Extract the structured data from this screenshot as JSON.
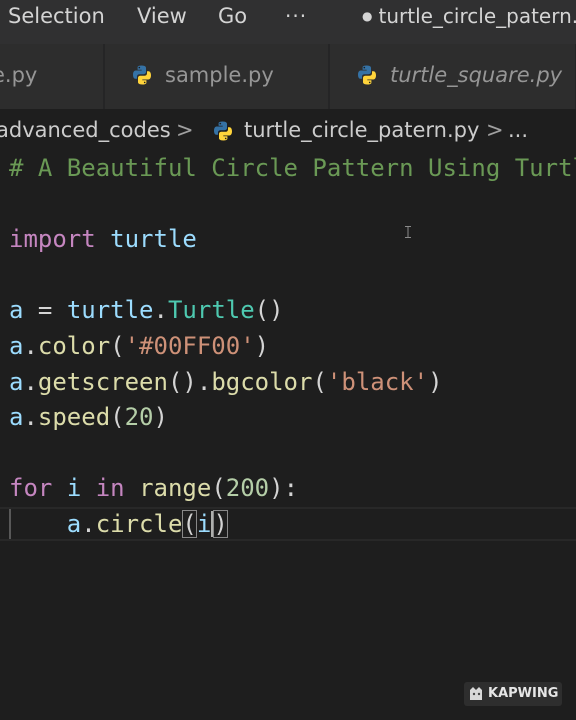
{
  "menu": {
    "items": [
      "Selection",
      "View",
      "Go",
      "···"
    ],
    "window_title": "turtle_circle_patern.py"
  },
  "tabs": [
    {
      "label": "turtle_circle.py",
      "visible_label": "e.py",
      "icon": "python-icon"
    },
    {
      "label": "sample.py",
      "icon": "python-icon"
    },
    {
      "label": "turtle_square.py",
      "icon": "python-icon",
      "italic": true
    }
  ],
  "breadcrumb": {
    "folder": "advanced_codes",
    "file": "turtle_circle_patern.py",
    "more": "...",
    "separator": ">"
  },
  "editor": {
    "lines": [
      [
        {
          "t": "# A Beautiful Circle Pattern Using Turtle",
          "c": "comment"
        }
      ],
      [],
      [
        {
          "t": "import",
          "c": "keyword"
        },
        {
          "t": " turtle",
          "c": "var"
        }
      ],
      [],
      [
        {
          "t": "a",
          "c": "var"
        },
        {
          "t": " = ",
          "c": "plain"
        },
        {
          "t": "turtle",
          "c": "var"
        },
        {
          "t": ".",
          "c": "plain"
        },
        {
          "t": "Turtle",
          "c": "class"
        },
        {
          "t": "()",
          "c": "plain"
        }
      ],
      [
        {
          "t": "a",
          "c": "var"
        },
        {
          "t": ".",
          "c": "plain"
        },
        {
          "t": "color",
          "c": "func"
        },
        {
          "t": "(",
          "c": "plain"
        },
        {
          "t": "'#00FF00'",
          "c": "string"
        },
        {
          "t": ")",
          "c": "plain"
        }
      ],
      [
        {
          "t": "a",
          "c": "var"
        },
        {
          "t": ".",
          "c": "plain"
        },
        {
          "t": "getscreen",
          "c": "func"
        },
        {
          "t": "().",
          "c": "plain"
        },
        {
          "t": "bgcolor",
          "c": "func"
        },
        {
          "t": "(",
          "c": "plain"
        },
        {
          "t": "'black'",
          "c": "string"
        },
        {
          "t": ")",
          "c": "plain"
        }
      ],
      [
        {
          "t": "a",
          "c": "var"
        },
        {
          "t": ".",
          "c": "plain"
        },
        {
          "t": "speed",
          "c": "func"
        },
        {
          "t": "(",
          "c": "plain"
        },
        {
          "t": "20",
          "c": "number"
        },
        {
          "t": ")",
          "c": "plain"
        }
      ],
      [],
      [
        {
          "t": "for",
          "c": "keyword"
        },
        {
          "t": " ",
          "c": "plain"
        },
        {
          "t": "i",
          "c": "var"
        },
        {
          "t": " ",
          "c": "plain"
        },
        {
          "t": "in",
          "c": "keyword"
        },
        {
          "t": " ",
          "c": "plain"
        },
        {
          "t": "range",
          "c": "func"
        },
        {
          "t": "(",
          "c": "plain"
        },
        {
          "t": "200",
          "c": "number"
        },
        {
          "t": "):",
          "c": "plain"
        }
      ],
      [
        {
          "t": "    ",
          "c": "plain"
        },
        {
          "t": "a",
          "c": "var"
        },
        {
          "t": ".",
          "c": "plain"
        },
        {
          "t": "circle",
          "c": "func"
        },
        {
          "t": "(",
          "c": "plain",
          "match": true
        },
        {
          "t": "i",
          "c": "var"
        },
        {
          "t": "|",
          "c": "cursor"
        },
        {
          "t": ")",
          "c": "plain",
          "match": true
        }
      ]
    ],
    "current_line": 10
  },
  "watermark": {
    "text": "KAPWING"
  },
  "colors": {
    "editor_bg": "#1e1e1e",
    "menubar_bg": "#303031",
    "tab_bg": "#2d2d2d",
    "comment": "#6a9955",
    "keyword": "#c586c0",
    "variable": "#9cdcfe",
    "class": "#4ec9b0",
    "function": "#dcdcaa",
    "string": "#ce9178",
    "number": "#b5cea8",
    "python_blue": "#3572a5",
    "python_yellow": "#ffd43b"
  }
}
